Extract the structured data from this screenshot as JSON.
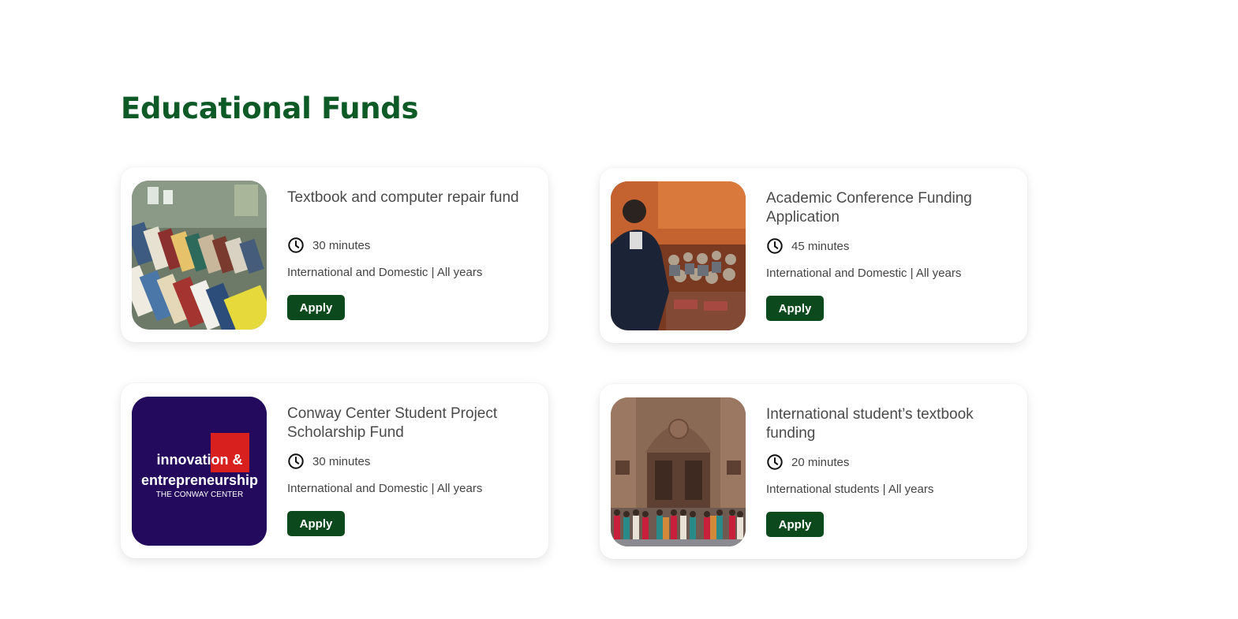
{
  "page": {
    "title": "Educational Funds"
  },
  "cards": [
    {
      "title": "Textbook and computer repair fund",
      "duration": "30 minutes",
      "eligibility": "International and Domestic | All years",
      "button": "Apply",
      "image": "bookstore-books-photo"
    },
    {
      "title": "Academic Conference Funding Application",
      "duration": "45 minutes",
      "eligibility": "International and Domestic | All years",
      "button": "Apply",
      "image": "conference-speaker-photo"
    },
    {
      "title": "Conway Center Student Project Scholarship Fund",
      "duration": "30 minutes",
      "eligibility": "International and Domestic | All years",
      "button": "Apply",
      "image": "conway-center-logo",
      "logo": {
        "line1": "innovation &",
        "line2": "entrepreneurship",
        "line3": "THE CONWAY CENTER"
      }
    },
    {
      "title": "International student’s textbook funding",
      "duration": "20 minutes",
      "eligibility": "International students | All years",
      "button": "Apply",
      "image": "group-photo-building"
    }
  ],
  "colors": {
    "title": "#0e5a27",
    "button": "#0c4a1d",
    "logo_bg": "#230a5c",
    "logo_square": "#d8201e"
  },
  "icons": {
    "duration": "clock-icon"
  }
}
